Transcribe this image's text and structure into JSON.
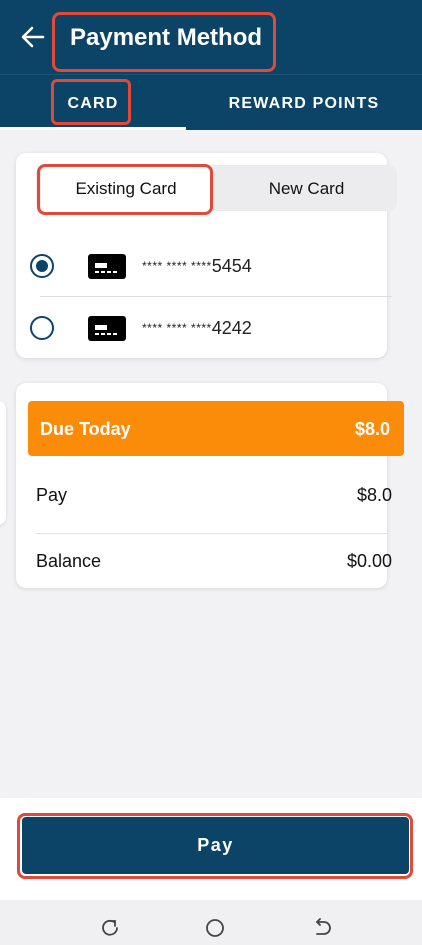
{
  "header": {
    "title": "Payment Method"
  },
  "tabs": [
    {
      "label": "CARD"
    },
    {
      "label": "REWARD POINTS"
    }
  ],
  "card_source": {
    "existing_label": "Existing Card",
    "new_label": "New Card"
  },
  "cards": [
    {
      "mask": "**** **** ****",
      "last4": "5454",
      "selected": true
    },
    {
      "mask": "**** **** ****",
      "last4": "4242",
      "selected": false
    }
  ],
  "summary": {
    "due_label": "Due Today",
    "due_value": "$8.0",
    "pay_label": "Pay",
    "pay_value": "$8.0",
    "balance_label": "Balance",
    "balance_value": "$0.00"
  },
  "footer": {
    "pay_button": "Pay"
  },
  "colors": {
    "primary": "#0b4466",
    "accent": "#fb8c0a",
    "highlight": "#e04a3a"
  },
  "icons": {
    "back": "arrow-left-icon",
    "card": "credit-card-icon"
  }
}
